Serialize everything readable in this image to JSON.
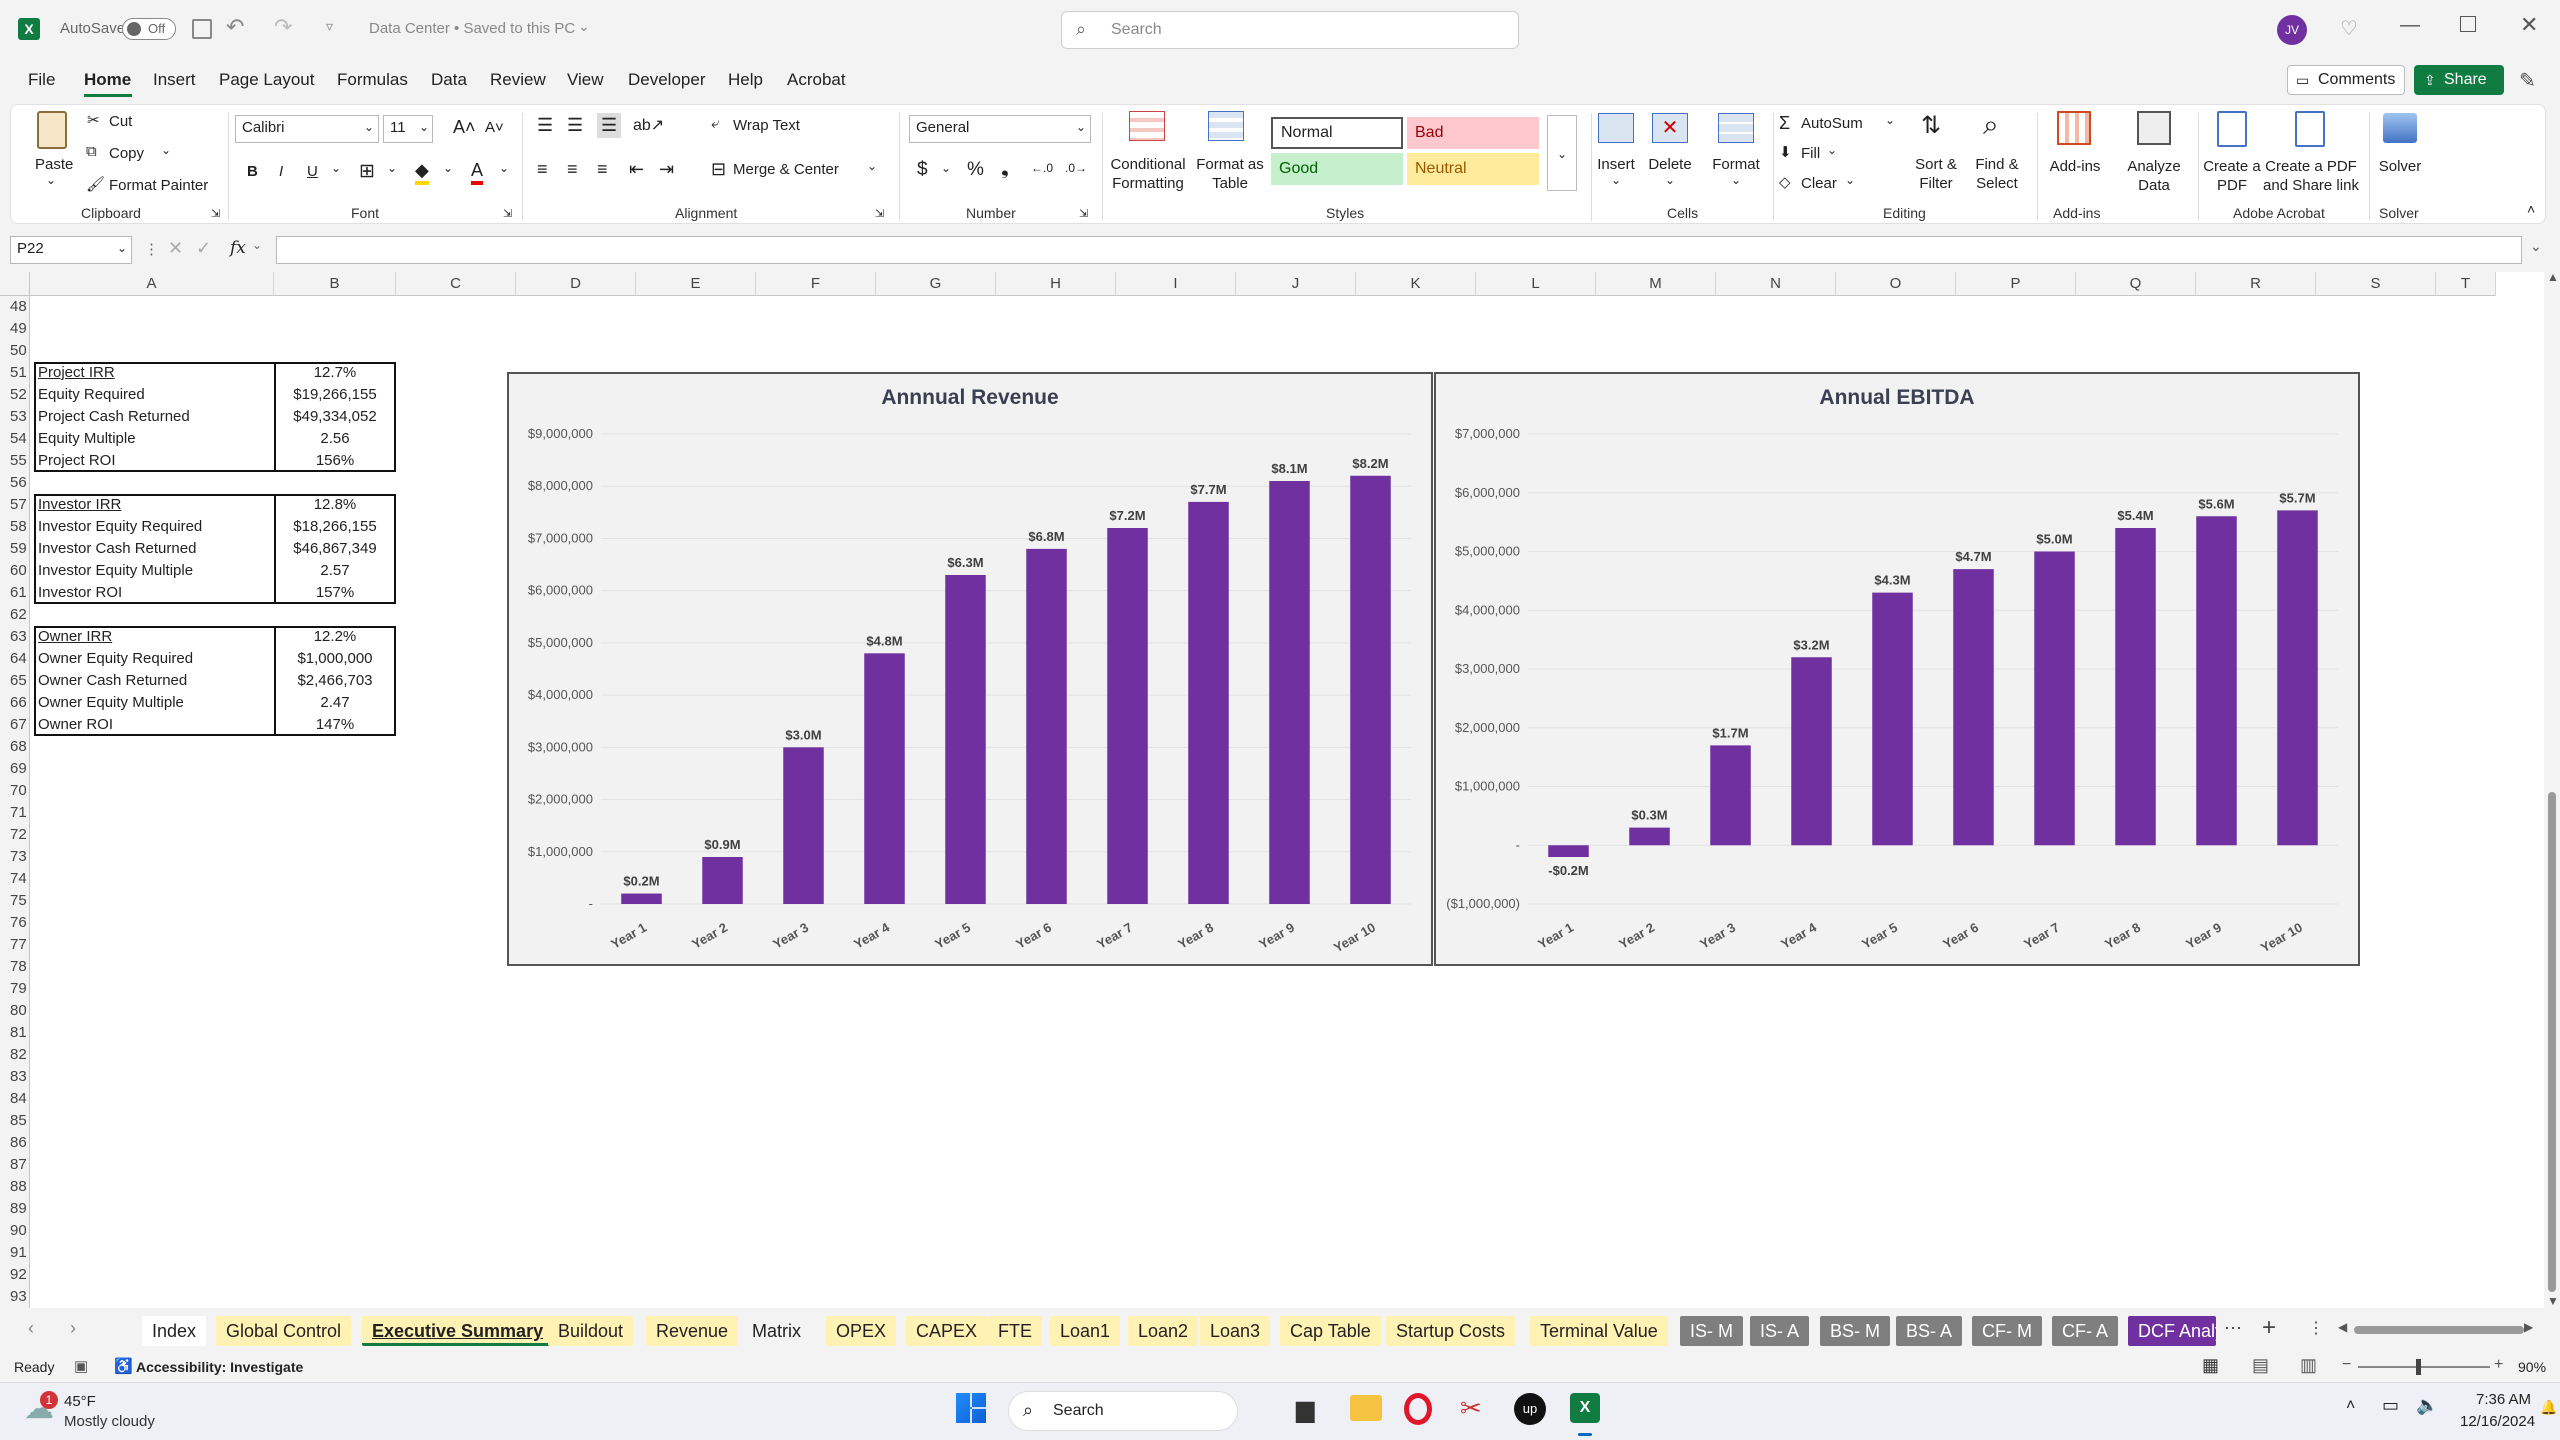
{
  "titlebar": {
    "autosave_label": "AutoSave",
    "autosave_state": "Off",
    "doc_title": "Data Center • Saved to this PC",
    "search_placeholder": "Search",
    "avatar_initials": "JV"
  },
  "menu": {
    "items": [
      "File",
      "Home",
      "Insert",
      "Page Layout",
      "Formulas",
      "Data",
      "Review",
      "View",
      "Developer",
      "Help",
      "Acrobat"
    ],
    "active": "Home",
    "comments_label": "Comments",
    "share_label": "Share"
  },
  "ribbon": {
    "clipboard": {
      "paste": "Paste",
      "cut": "Cut",
      "copy": "Copy",
      "format_painter": "Format Painter",
      "label": "Clipboard"
    },
    "font": {
      "name": "Calibri",
      "size": "11",
      "label": "Font"
    },
    "alignment": {
      "wrap": "Wrap Text",
      "merge": "Merge & Center",
      "label": "Alignment"
    },
    "number": {
      "format": "General",
      "label": "Number"
    },
    "styles": {
      "conditional": "Conditional Formatting",
      "format_as_table": "Format as Table",
      "normal": "Normal",
      "bad": "Bad",
      "good": "Good",
      "neutral": "Neutral",
      "label": "Styles"
    },
    "cells": {
      "insert": "Insert",
      "delete": "Delete",
      "format": "Format",
      "label": "Cells"
    },
    "editing": {
      "autosum": "AutoSum",
      "fill": "Fill",
      "clear": "Clear",
      "sort": "Sort & Filter",
      "find": "Find & Select",
      "label": "Editing"
    },
    "addins": {
      "addins": "Add-ins",
      "analyze": "Analyze Data",
      "label": "Add-ins"
    },
    "acrobat": {
      "create_pdf": "Create a PDF",
      "create_share": "Create a PDF and Share link",
      "label": "Adobe Acrobat"
    },
    "solver": {
      "solver": "Solver",
      "label": "Solver"
    }
  },
  "formula_bar": {
    "name_box": "P22",
    "fx": "fx",
    "content": ""
  },
  "columns": [
    "A",
    "B",
    "C",
    "D",
    "E",
    "F",
    "G",
    "H",
    "I",
    "J",
    "K",
    "L",
    "M",
    "N",
    "O",
    "P",
    "Q",
    "R",
    "S",
    "T"
  ],
  "rows": [
    "48",
    "49",
    "50",
    "51",
    "52",
    "53",
    "54",
    "55",
    "56",
    "57",
    "58",
    "59",
    "60",
    "61",
    "62",
    "63",
    "64",
    "65",
    "66",
    "67",
    "68",
    "69",
    "70",
    "71",
    "72",
    "73",
    "74",
    "75",
    "76",
    "77",
    "78",
    "79",
    "80",
    "81",
    "82",
    "83",
    "84",
    "85",
    "86",
    "87",
    "88",
    "89",
    "90",
    "91",
    "92",
    "93"
  ],
  "tables": [
    {
      "rows": [
        {
          "label": "Project IRR",
          "value": "12.7%"
        },
        {
          "label": "Equity Required",
          "value": "$19,266,155"
        },
        {
          "label": "Project Cash Returned",
          "value": "$49,334,052"
        },
        {
          "label": "Equity Multiple",
          "value": "2.56"
        },
        {
          "label": "Project ROI",
          "value": "156%"
        }
      ]
    },
    {
      "rows": [
        {
          "label": "Investor IRR",
          "value": "12.8%"
        },
        {
          "label": "Investor Equity Required",
          "value": "$18,266,155"
        },
        {
          "label": "Investor Cash Returned",
          "value": "$46,867,349"
        },
        {
          "label": "Investor Equity Multiple",
          "value": "2.57"
        },
        {
          "label": "Investor ROI",
          "value": "157%"
        }
      ]
    },
    {
      "rows": [
        {
          "label": "Owner IRR",
          "value": "12.2%"
        },
        {
          "label": "Owner Equity Required",
          "value": "$1,000,000"
        },
        {
          "label": "Owner Cash Returned",
          "value": "$2,466,703"
        },
        {
          "label": "Owner Equity Multiple",
          "value": "2.47"
        },
        {
          "label": "Owner ROI",
          "value": "147%"
        }
      ]
    }
  ],
  "chart_data": [
    {
      "type": "bar",
      "title": "Annnual Revenue",
      "categories": [
        "Year 1",
        "Year 2",
        "Year 3",
        "Year 4",
        "Year 5",
        "Year 6",
        "Year 7",
        "Year 8",
        "Year 9",
        "Year 10"
      ],
      "values": [
        200000,
        900000,
        3000000,
        4800000,
        6300000,
        6800000,
        7200000,
        7700000,
        8100000,
        8200000
      ],
      "data_labels": [
        "$0.2M",
        "$0.9M",
        "$3.0M",
        "$4.8M",
        "$6.3M",
        "$6.8M",
        "$7.2M",
        "$7.7M",
        "$8.1M",
        "$8.2M"
      ],
      "yticks": [
        "-",
        "$1,000,000",
        "$2,000,000",
        "$3,000,000",
        "$4,000,000",
        "$5,000,000",
        "$6,000,000",
        "$7,000,000",
        "$8,000,000",
        "$9,000,000"
      ],
      "ylim": [
        0,
        9000000
      ],
      "color": "#7030a0"
    },
    {
      "type": "bar",
      "title": "Annual EBITDA",
      "categories": [
        "Year 1",
        "Year 2",
        "Year 3",
        "Year 4",
        "Year 5",
        "Year 6",
        "Year 7",
        "Year 8",
        "Year 9",
        "Year 10"
      ],
      "values": [
        -200000,
        300000,
        1700000,
        3200000,
        4300000,
        4700000,
        5000000,
        5400000,
        5600000,
        5700000
      ],
      "data_labels": [
        "-$0.2M",
        "$0.3M",
        "$1.7M",
        "$3.2M",
        "$4.3M",
        "$4.7M",
        "$5.0M",
        "$5.4M",
        "$5.6M",
        "$5.7M"
      ],
      "yticks": [
        "($1,000,000)",
        "-",
        "$1,000,000",
        "$2,000,000",
        "$3,000,000",
        "$4,000,000",
        "$5,000,000",
        "$6,000,000",
        "$7,000,000"
      ],
      "ylim": [
        -1000000,
        7000000
      ],
      "color": "#7030a0"
    }
  ],
  "sheet_tabs": [
    {
      "label": "Index",
      "bg": "#ffffff",
      "fg": "#222222"
    },
    {
      "label": "Global Control",
      "bg": "#fff2b3",
      "fg": "#222222"
    },
    {
      "label": "Executive Summary",
      "bg": "#fff2b3",
      "fg": "#222222",
      "active": true
    },
    {
      "label": "Buildout",
      "bg": "#fff2b3",
      "fg": "#222222"
    },
    {
      "label": "Revenue",
      "bg": "#fff2b3",
      "fg": "#222222"
    },
    {
      "label": "Matrix",
      "bg": "#f3f3f3",
      "fg": "#222222"
    },
    {
      "label": "OPEX",
      "bg": "#fff2b3",
      "fg": "#222222"
    },
    {
      "label": "CAPEX",
      "bg": "#fff2b3",
      "fg": "#222222"
    },
    {
      "label": "FTE",
      "bg": "#fff2b3",
      "fg": "#222222"
    },
    {
      "label": "Loan1",
      "bg": "#fff2b3",
      "fg": "#222222"
    },
    {
      "label": "Loan2",
      "bg": "#fff2b3",
      "fg": "#222222"
    },
    {
      "label": "Loan3",
      "bg": "#fff2b3",
      "fg": "#222222"
    },
    {
      "label": "Cap Table",
      "bg": "#fff2b3",
      "fg": "#222222"
    },
    {
      "label": "Startup Costs",
      "bg": "#fff2b3",
      "fg": "#222222"
    },
    {
      "label": "Terminal Value",
      "bg": "#fff2b3",
      "fg": "#222222"
    },
    {
      "label": "IS- M",
      "bg": "#7f7f7f",
      "fg": "#ffffff"
    },
    {
      "label": "IS- A",
      "bg": "#7f7f7f",
      "fg": "#ffffff"
    },
    {
      "label": "BS- M",
      "bg": "#7f7f7f",
      "fg": "#ffffff"
    },
    {
      "label": "BS- A",
      "bg": "#7f7f7f",
      "fg": "#ffffff"
    },
    {
      "label": "CF- M",
      "bg": "#7f7f7f",
      "fg": "#ffffff"
    },
    {
      "label": "CF- A",
      "bg": "#7f7f7f",
      "fg": "#ffffff"
    },
    {
      "label": "DCF Analy",
      "bg": "#7030a0",
      "fg": "#ffffff"
    }
  ],
  "status": {
    "ready": "Ready",
    "accessibility": "Accessibility: Investigate",
    "zoom": "90%"
  },
  "taskbar": {
    "weather_temp": "45°F",
    "weather_desc": "Mostly cloudy",
    "weather_badge": "1",
    "search": "Search",
    "time": "7:36 AM",
    "date": "12/16/2024"
  }
}
